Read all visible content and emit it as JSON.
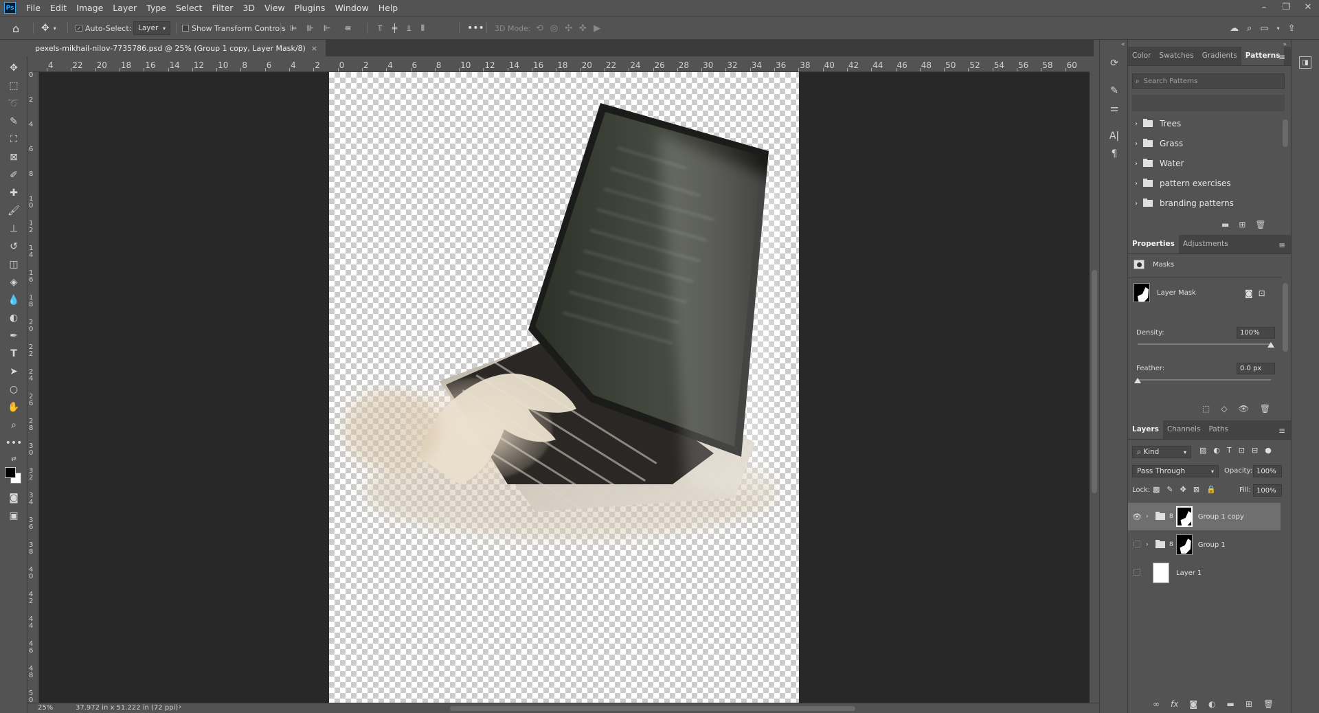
{
  "menu": [
    "File",
    "Edit",
    "Image",
    "Layer",
    "Type",
    "Select",
    "Filter",
    "3D",
    "View",
    "Plugins",
    "Window",
    "Help"
  ],
  "window": {
    "minimize": "–",
    "restore": "❐",
    "close": "✕"
  },
  "options": {
    "auto_select_label": "Auto-Select:",
    "auto_select_value": "Layer",
    "show_transform": "Show Transform Controls",
    "mode_3d": "3D Mode:"
  },
  "document": {
    "tab_title": "pexels-mikhail-nilov-7735786.psd @ 25% (Group 1 copy, Layer Mask/8)",
    "close": "×"
  },
  "ruler_h": [
    "4",
    "22",
    "20",
    "18",
    "16",
    "14",
    "12",
    "10",
    "8",
    "6",
    "4",
    "2",
    "0",
    "2",
    "4",
    "6",
    "8",
    "10",
    "12",
    "14",
    "16",
    "18",
    "20",
    "22",
    "24",
    "26",
    "28",
    "30",
    "32",
    "34",
    "36",
    "38",
    "40",
    "42",
    "44",
    "46",
    "48",
    "50",
    "52",
    "54",
    "56",
    "58",
    "60"
  ],
  "ruler_v": [
    "0",
    "2",
    "4",
    "6",
    "8",
    "1 0",
    "1 2",
    "1 4",
    "1 6",
    "1 8",
    "2 0",
    "2 2",
    "2 4",
    "2 6",
    "2 8",
    "3 0",
    "3 2",
    "3 4",
    "3 6",
    "3 8",
    "4 0",
    "4 2",
    "4 4",
    "4 6",
    "4 8",
    "5 0"
  ],
  "status": {
    "zoom": "25%",
    "dims": "37.972 in x 51.222 in (72 ppi)",
    "arrow": "›"
  },
  "patterns_panel": {
    "tabs": [
      "Color",
      "Swatches",
      "Gradients",
      "Patterns"
    ],
    "search_placeholder": "Search Patterns",
    "folders": [
      "Trees",
      "Grass",
      "Water",
      "pattern exercises",
      "branding patterns"
    ]
  },
  "properties_panel": {
    "tabs": [
      "Properties",
      "Adjustments"
    ],
    "masks_label": "Masks",
    "layer_mask_label": "Layer Mask",
    "density_label": "Density:",
    "density_value": "100%",
    "density_fraction": 1.0,
    "feather_label": "Feather:",
    "feather_value": "0.0 px",
    "feather_fraction": 0.0
  },
  "layers_panel": {
    "tabs": [
      "Layers",
      "Channels",
      "Paths"
    ],
    "kind_label": "Kind",
    "blend_mode": "Pass Through",
    "opacity_label": "Opacity:",
    "opacity_value": "100%",
    "lock_label": "Lock:",
    "fill_label": "Fill:",
    "fill_value": "100%",
    "layers": [
      {
        "name": "Group 1 copy",
        "visible": true,
        "selected": true
      },
      {
        "name": "Group 1",
        "visible": false,
        "selected": false
      },
      {
        "name": "Layer 1",
        "visible": false,
        "selected": false
      }
    ]
  },
  "colors": {
    "accent": "#31a8ff",
    "canvas_bg": "#282828",
    "panel_bg": "#535353"
  }
}
